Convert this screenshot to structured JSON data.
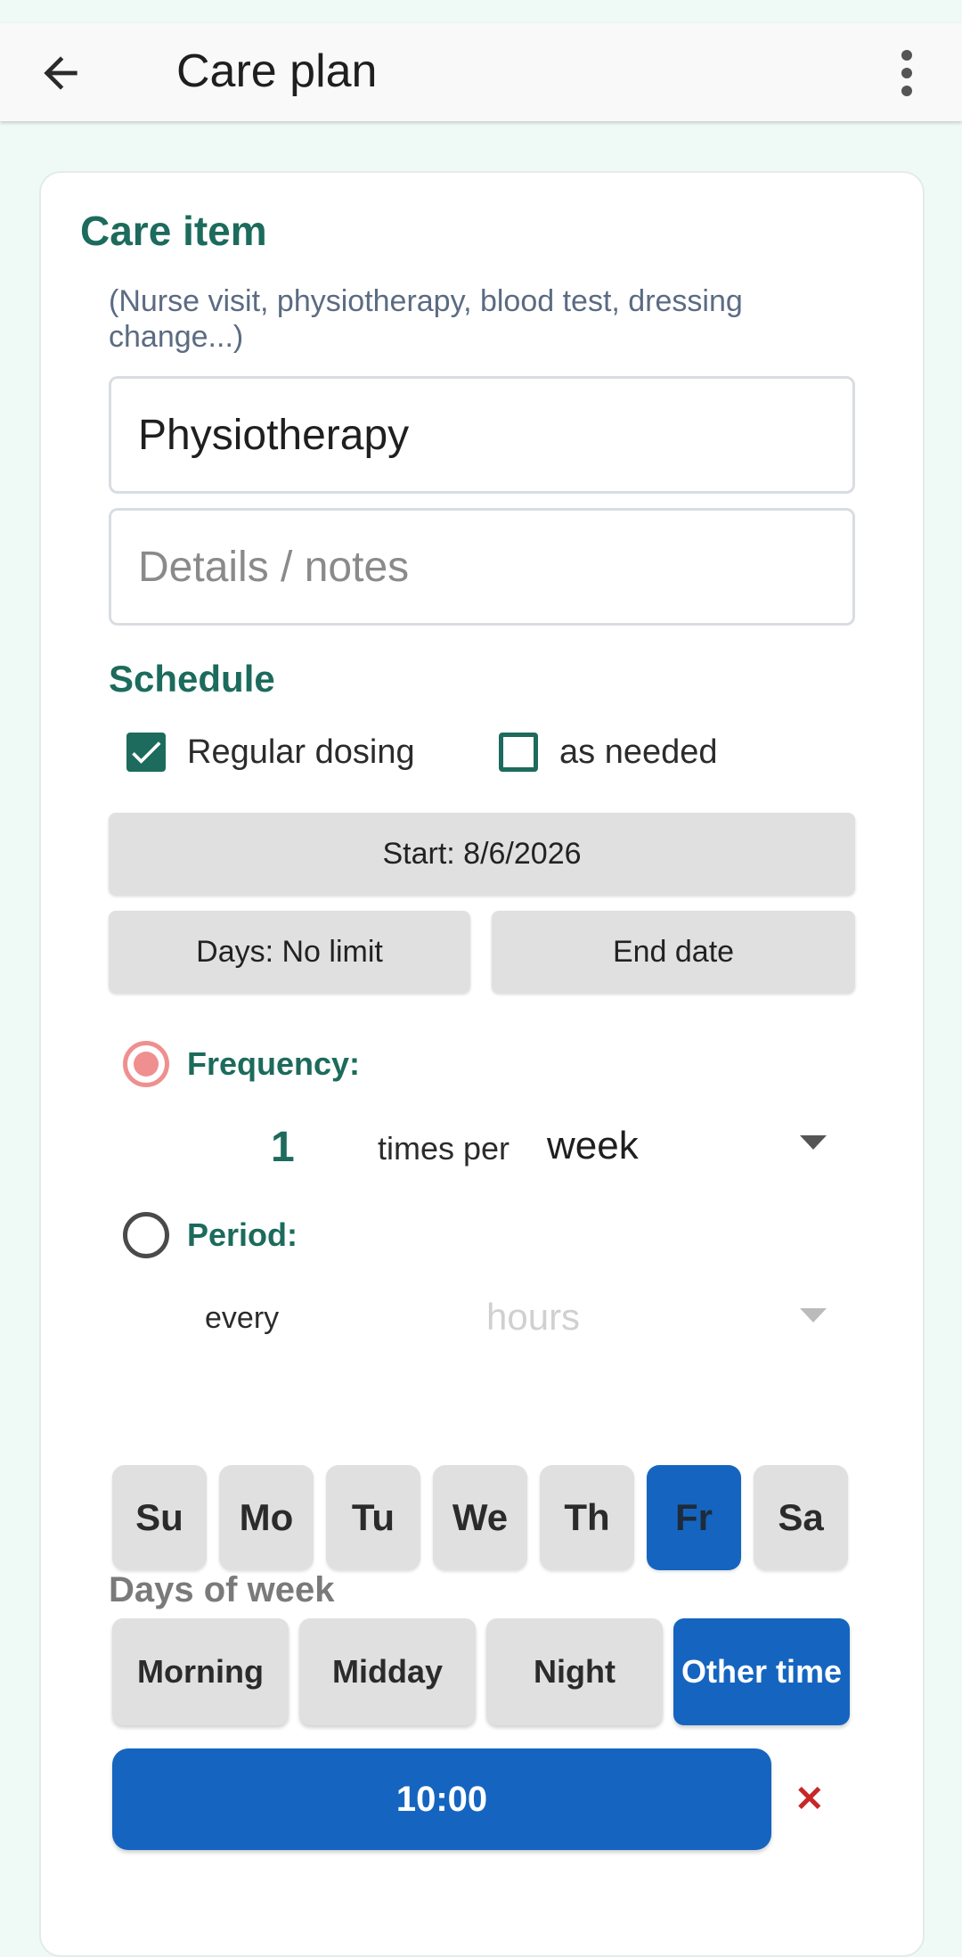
{
  "appbar": {
    "title": "Care plan"
  },
  "care_item": {
    "heading": "Care item",
    "hint": "(Nurse visit, physiotherapy, blood test, dressing change...)",
    "name_value": "Physiotherapy",
    "notes_placeholder": "Details / notes"
  },
  "schedule": {
    "heading": "Schedule",
    "regular_label": "Regular dosing",
    "as_needed_label": "as needed",
    "start_label": "Start: 8/6/2026",
    "days_label": "Days: No limit",
    "end_date_label": "End date"
  },
  "frequency": {
    "label": "Frequency:",
    "count": "1",
    "times_per": "times per",
    "unit": "week"
  },
  "period": {
    "label": "Period:",
    "every": "every",
    "unit_placeholder": "hours"
  },
  "days_of_week": {
    "heading": "Days of week",
    "days": [
      "Su",
      "Mo",
      "Tu",
      "We",
      "Th",
      "Fr",
      "Sa"
    ],
    "selected": "Fr"
  },
  "time_slots": {
    "labels": [
      "Morning",
      "Midday",
      "Night",
      "Other time"
    ],
    "selected": "Other time",
    "time_value": "10:00",
    "remove_symbol": "✕"
  },
  "colors": {
    "accent": "#1c6b5c",
    "selected": "#1565c0",
    "radio_active": "#ef8f8f",
    "remove": "#c62828"
  }
}
